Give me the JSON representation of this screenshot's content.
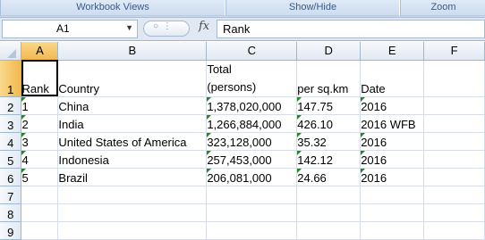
{
  "ribbon": {
    "groups": [
      "Workbook Views",
      "Show/Hide",
      "Zoom"
    ]
  },
  "formula_bar": {
    "name_box": "A1",
    "fx_symbol": "fx",
    "formula": "Rank"
  },
  "sheet": {
    "columns": [
      "A",
      "B",
      "C",
      "D",
      "E",
      "F"
    ],
    "row_numbers": [
      "1",
      "2",
      "3",
      "4",
      "5",
      "6",
      "7",
      "8",
      "9"
    ],
    "header_row": {
      "a": "Rank",
      "b": "Country",
      "c_line1": "Total",
      "c_line2": "(persons)",
      "d": "per sq.km",
      "e": "Date"
    },
    "rows": [
      {
        "rank": "1",
        "country": "China",
        "total": "1,378,020,000",
        "density": "147.75",
        "date": "2016"
      },
      {
        "rank": "2",
        "country": "India",
        "total": "1,266,884,000",
        "density": "426.10",
        "date": "2016 WFB"
      },
      {
        "rank": "3",
        "country": "United States of America",
        "total": "323,128,000",
        "density": "35.32",
        "date": "2016"
      },
      {
        "rank": "4",
        "country": "Indonesia",
        "total": "257,453,000",
        "density": "142.12",
        "date": "2016"
      },
      {
        "rank": "5",
        "country": "Brazil",
        "total": "206,081,000",
        "density": "24.66",
        "date": "2016"
      }
    ]
  },
  "colors": {
    "header_bg": "#e1e9f3",
    "selected_header": "#f2b84e",
    "gridline": "#d6dde6",
    "text_marker": "#1f8a1f"
  }
}
